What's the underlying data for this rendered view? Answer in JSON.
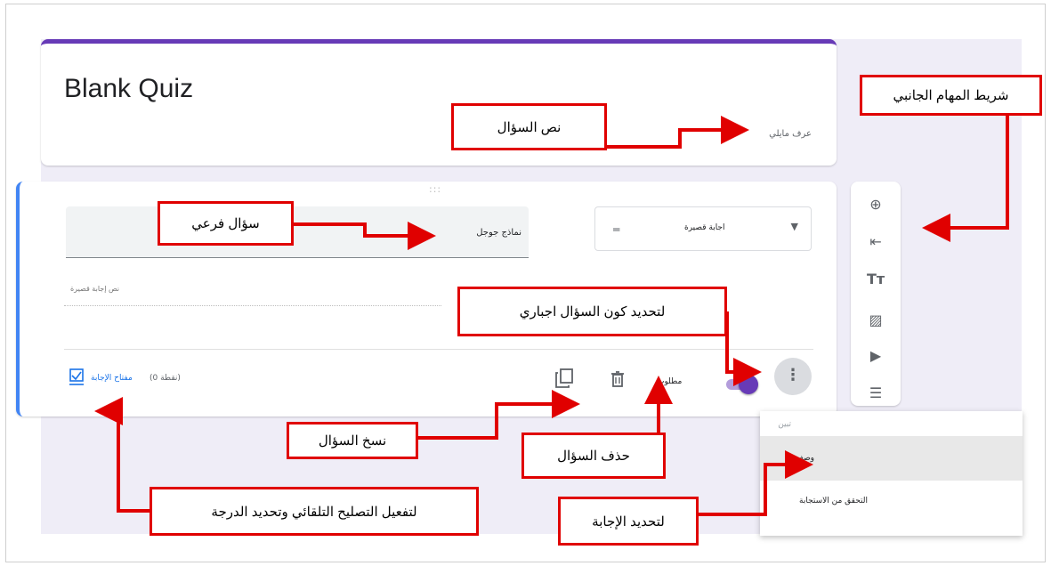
{
  "form": {
    "title": "Blank Quiz",
    "description": "عرف مايلي",
    "question_placeholder": "نماذج جوجل",
    "question_type": "اجابة قصيرة",
    "short_answer_placeholder": "نص إجابة قصيرة",
    "answer_key": "مفتاح الإجابة",
    "points": "(نقطة 0)",
    "required_label": "مطلوب",
    "drag_handle": ":::"
  },
  "menu": {
    "items": [
      {
        "label": "تبين",
        "state": "faded"
      },
      {
        "label": "وصف",
        "state": "highlighted"
      },
      {
        "label": "التحقق من الاستجابة",
        "state": "normal"
      }
    ]
  },
  "sidebar": {
    "icons": [
      "add-question-icon",
      "import-questions-icon",
      "add-title-icon",
      "add-image-icon",
      "add-video-icon",
      "add-section-icon"
    ]
  },
  "callouts": {
    "sidebar": "شريط المهام الجانبي",
    "question_text": "نص السؤال",
    "sub_question": "سؤال فرعي",
    "required": "لتحديد كون السؤال اجباري",
    "copy": "نسخ السؤال",
    "delete": "حذف السؤال",
    "answer_key": "لتفعيل التصليح التلقائي وتحديد الدرجة",
    "answer": "لتحديد الإجابة"
  },
  "colors": {
    "accent": "#673ab7",
    "background": "#efedf7",
    "callout_border": "#e00000",
    "link": "#1a73e8",
    "active_border": "#4285f4"
  }
}
